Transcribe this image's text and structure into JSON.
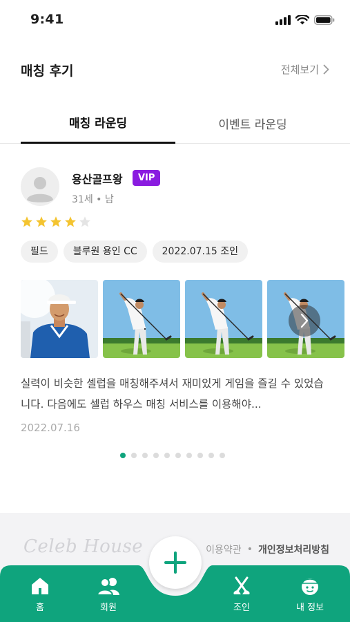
{
  "status": {
    "time": "9:41"
  },
  "header": {
    "title": "매칭 후기",
    "view_all": "전체보기"
  },
  "tabs": [
    {
      "label": "매칭 라운딩",
      "active": true
    },
    {
      "label": "이벤트 라운딩",
      "active": false
    }
  ],
  "review": {
    "user_name": "용산골프왕",
    "badge": "VIP",
    "meta": "31세 • 남",
    "rating": 4,
    "rating_max": 5,
    "chips": [
      "필드",
      "블루원 용인 CC",
      "2022.07.15 조인"
    ],
    "photos": [
      "golfer-portrait",
      "golfer-swing",
      "golfer-swing",
      "golfer-swing"
    ],
    "text": "실력이 비슷한 셀럽을 매칭해주셔서 재미있게 게임을 즐길 수 있었습니다. 다음에도 셀럽 하우스 매칭 서비스를 이용해야...",
    "date": "2022.07.16"
  },
  "pagination": {
    "count": 10,
    "active_index": 0
  },
  "footer": {
    "logo": "Celeb House",
    "terms": "이용약관",
    "separator": "•",
    "privacy": "개인정보처리방침"
  },
  "tabbar": {
    "items": [
      {
        "label": "홈",
        "icon": "home-icon"
      },
      {
        "label": "회원",
        "icon": "members-icon"
      },
      {
        "label": "조인",
        "icon": "golf-clubs-icon"
      },
      {
        "label": "내 정보",
        "icon": "profile-icon"
      }
    ],
    "fab_icon": "plus-icon"
  },
  "colors": {
    "primary": "#0fa47d",
    "vip": "#8a1ce0",
    "star": "#f4c430",
    "star_empty": "#e4e4e4"
  }
}
